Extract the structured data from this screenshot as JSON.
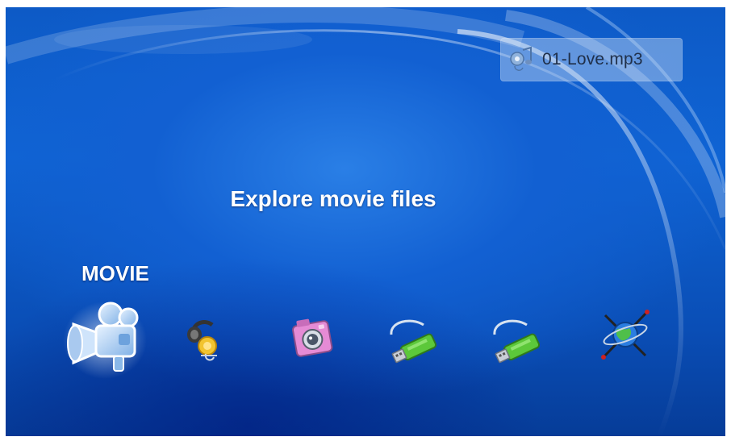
{
  "now_playing": {
    "filename": "01-Love.mp3",
    "icon": "music-note-icon"
  },
  "hint": "Explore movie files",
  "selected_label": "MOVIE",
  "menu": [
    {
      "id": "movie",
      "icon": "movie-camera-icon",
      "selected": true
    },
    {
      "id": "music",
      "icon": "headphones-icon",
      "selected": false
    },
    {
      "id": "photo",
      "icon": "photo-camera-icon",
      "selected": false
    },
    {
      "id": "usb1",
      "icon": "usb-drive-icon",
      "selected": false
    },
    {
      "id": "usb2",
      "icon": "usb-drive-icon",
      "selected": false
    },
    {
      "id": "network",
      "icon": "network-globe-icon",
      "selected": false
    }
  ],
  "colors": {
    "background": "#0f64d4",
    "text": "#ffffff",
    "usb_green": "#5cc83a"
  }
}
